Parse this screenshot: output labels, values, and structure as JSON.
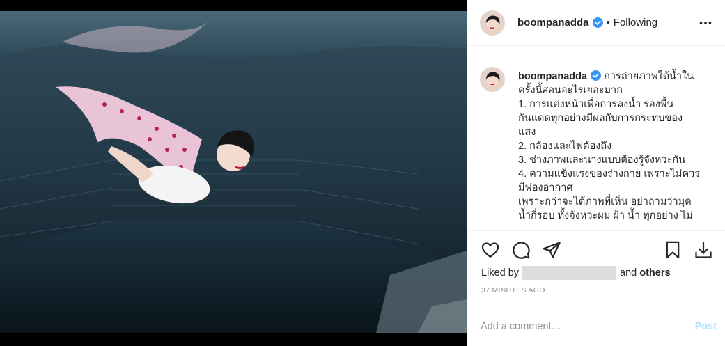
{
  "photo": {
    "description_icon": "underwater-photo"
  },
  "header": {
    "username": "boompanadda",
    "separator": "•",
    "follow_status": "Following"
  },
  "caption": {
    "username": "boompanadda",
    "lines": [
      "การถ่ายภาพใต้น้ำใน",
      "ครั้งนี้สอนอะไรเยอะมาก",
      "1. การแต่งหน้าเพื่อการลงน้ำ รองพื้น",
      "กันแดดทุกอย่างมีผลกับการกระทบของ",
      "แสง",
      "2. กล้องและไฟต้องถึง",
      "3. ช่างภาพและนางแบบต้องรู้จังหวะกัน",
      "4. ความแข็งแรงของร่างกาย เพราะไม่ควร",
      "มีฟองอากาศ",
      "เพราะกว่าจะได้ภาพที่เห็น อย่าถามว่ามุด",
      "น้ำกี่รอบ ทั้งจังหวะผม ผ้า น้ำ ทุกอย่าง ไม่"
    ]
  },
  "likes": {
    "prefix": "Liked by",
    "connector": "and",
    "others": "others"
  },
  "timestamp": "37 MINUTES AGO",
  "comment": {
    "placeholder": "Add a comment…",
    "post_label": "Post"
  },
  "colors": {
    "verified": "#3897f0",
    "post_disabled": "#b2dffc",
    "muted": "#8e8e8e"
  }
}
